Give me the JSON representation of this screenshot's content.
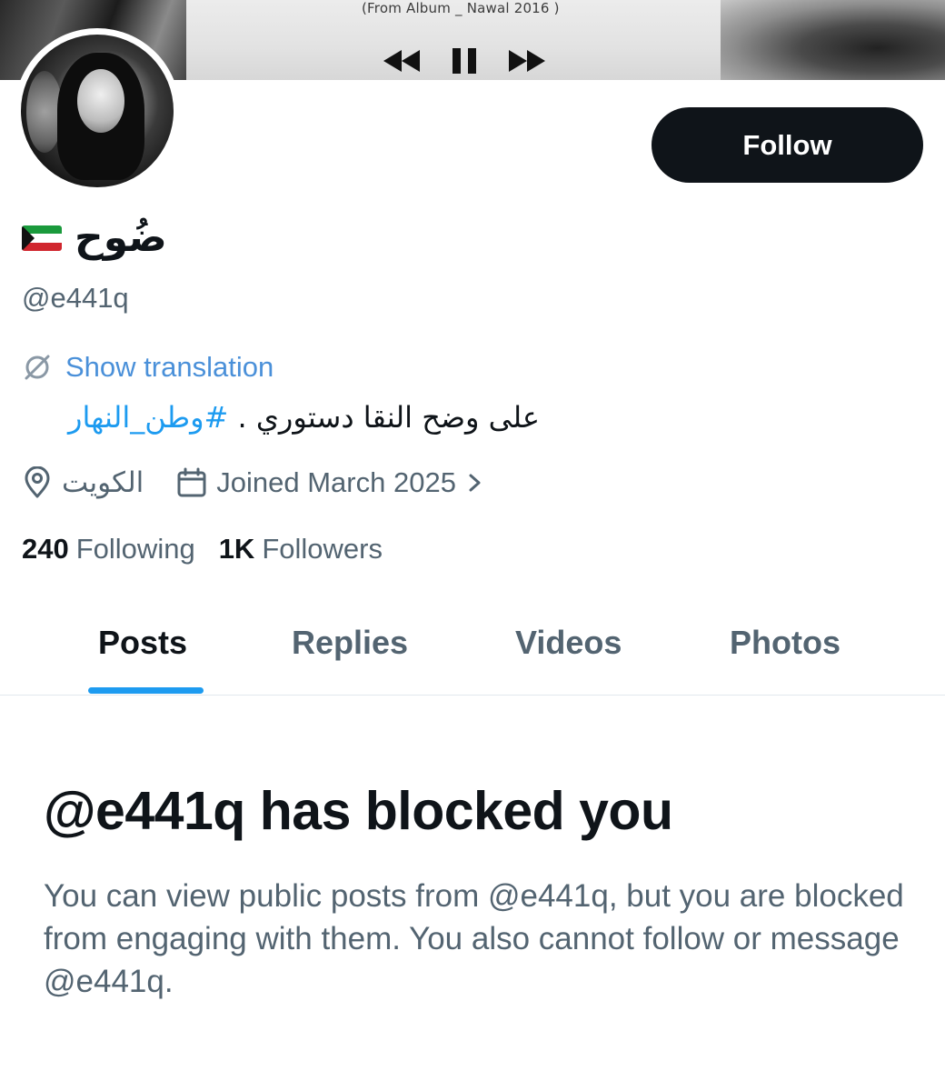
{
  "banner": {
    "album_caption": "(From Album _ Nawal 2016 )",
    "controls": [
      "rewind-icon",
      "pause-icon",
      "fast-forward-icon"
    ]
  },
  "profile": {
    "display_name": "ضُوح",
    "flag": "kuwait-flag-icon",
    "handle": "@e441q",
    "follow_label": "Follow",
    "translation_label": "Show translation",
    "bio_text": "على وضح النقا دستوري . ",
    "bio_hashtag": "#وطن_النهار",
    "location": "الكويت",
    "joined": "Joined March 2025",
    "following_count": "240",
    "following_label": "Following",
    "followers_count": "1K",
    "followers_label": "Followers"
  },
  "tabs": [
    {
      "label": "Posts",
      "active": true
    },
    {
      "label": "Replies",
      "active": false
    },
    {
      "label": "Videos",
      "active": false
    },
    {
      "label": "Photos",
      "active": false
    }
  ],
  "blocked": {
    "title": "@e441q has blocked you",
    "body": "You can view public posts from @e441q, but you are blocked from engaging with them. You also cannot follow or message @e441q."
  },
  "colors": {
    "accent": "#1d9bf0",
    "text_primary": "#0f1419",
    "text_secondary": "#536471",
    "button_bg": "#0f1419"
  }
}
